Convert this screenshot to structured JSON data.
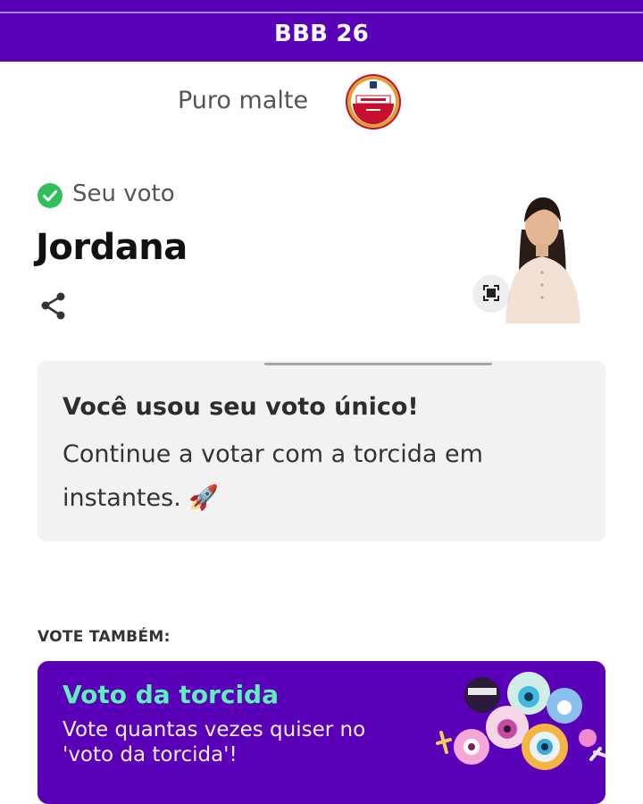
{
  "header": {
    "title": "BBB 26"
  },
  "sponsor": {
    "tagline": "Puro malte",
    "logo_icon": "amstel-logo-icon"
  },
  "vote": {
    "status_label": "Seu voto",
    "status_icon": "check-circle-icon",
    "candidate_name": "Jordana",
    "share_icon": "share-icon",
    "expand_icon": "expand-icon"
  },
  "info_card": {
    "headline": "Você usou seu voto único!",
    "body": "Continue a votar com a torcida em instantes. 🚀"
  },
  "vote_also": {
    "label": "VOTE TAMBÉM:",
    "card": {
      "title": "Voto da torcida",
      "description": "Vote quantas vezes quiser no 'voto da torcida'!"
    }
  },
  "colors": {
    "brand_purple": "#5a00b8",
    "accent_green": "#5ff0b9",
    "check_green": "#2fbf5d",
    "card_bg": "#f2f2f2"
  }
}
